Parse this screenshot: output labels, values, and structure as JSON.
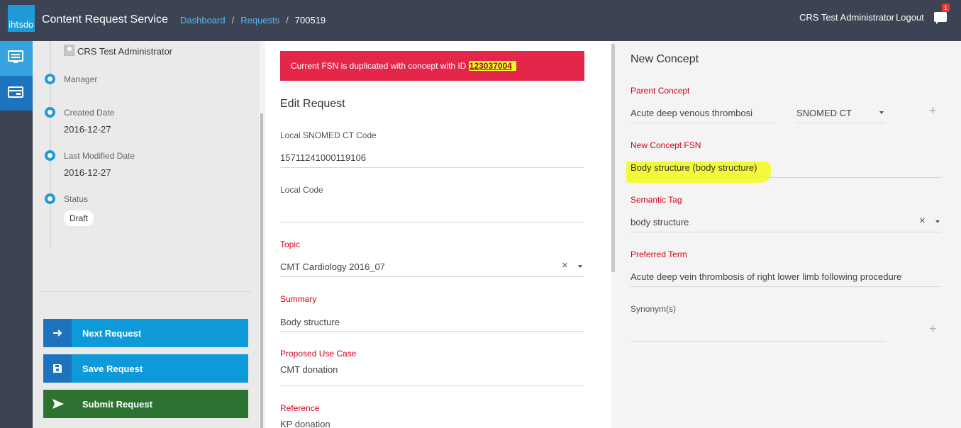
{
  "header": {
    "logo_text": "ihtsdo",
    "app_title": "Content Request Service",
    "breadcrumb": [
      "Dashboard",
      "Requests",
      "700519"
    ],
    "user_name": "CRS Test Administrator",
    "logout_label": "Logout",
    "notification_count": "1"
  },
  "sidebar": {
    "owner_name": "CRS Test Administrator",
    "timeline": [
      {
        "label": "Manager",
        "value": ""
      },
      {
        "label": "Created Date",
        "value": "2016-12-27"
      },
      {
        "label": "Last Modified Date",
        "value": "2016-12-27"
      },
      {
        "label": "Status",
        "value": "Draft"
      }
    ],
    "actions": {
      "next": "Next Request",
      "save": "Save Request",
      "submit": "Submit Request"
    }
  },
  "alert": {
    "message": "Current FSN is duplicated with concept with ID",
    "concept_id": "123037004"
  },
  "edit_request": {
    "title": "Edit Request",
    "fields": {
      "local_snomed_label": "Local SNOMED CT Code",
      "local_snomed_value": "15711241000119106",
      "local_code_label": "Local Code",
      "local_code_value": "",
      "topic_label": "Topic",
      "topic_value": "CMT Cardiology 2016_07",
      "summary_label": "Summary",
      "summary_value": "Body structure",
      "use_case_label": "Proposed Use Case",
      "use_case_value": "CMT donation",
      "reference_label": "Reference",
      "reference_value": "KP donation"
    }
  },
  "new_concept": {
    "title": "New Concept",
    "parent_label": "Parent Concept",
    "parent_value": "Acute deep venous thrombosi",
    "parent_source": "SNOMED CT",
    "fsn_label": "New Concept FSN",
    "fsn_value": "Body structure (body structure)",
    "semantic_tag_label": "Semantic Tag",
    "semantic_tag_value": "body structure",
    "preferred_term_label": "Preferred Term",
    "preferred_term_value": "Acute deep vein thrombosis of right lower limb following procedure",
    "synonyms_label": "Synonym(s)",
    "synonyms_value": ""
  },
  "colors": {
    "topbar": "#3c4453",
    "accent": "#1e9ad6",
    "alert": "#e5264b",
    "submit": "#2c7332",
    "required_label": "#d0021b",
    "highlight": "#f3f91a"
  }
}
